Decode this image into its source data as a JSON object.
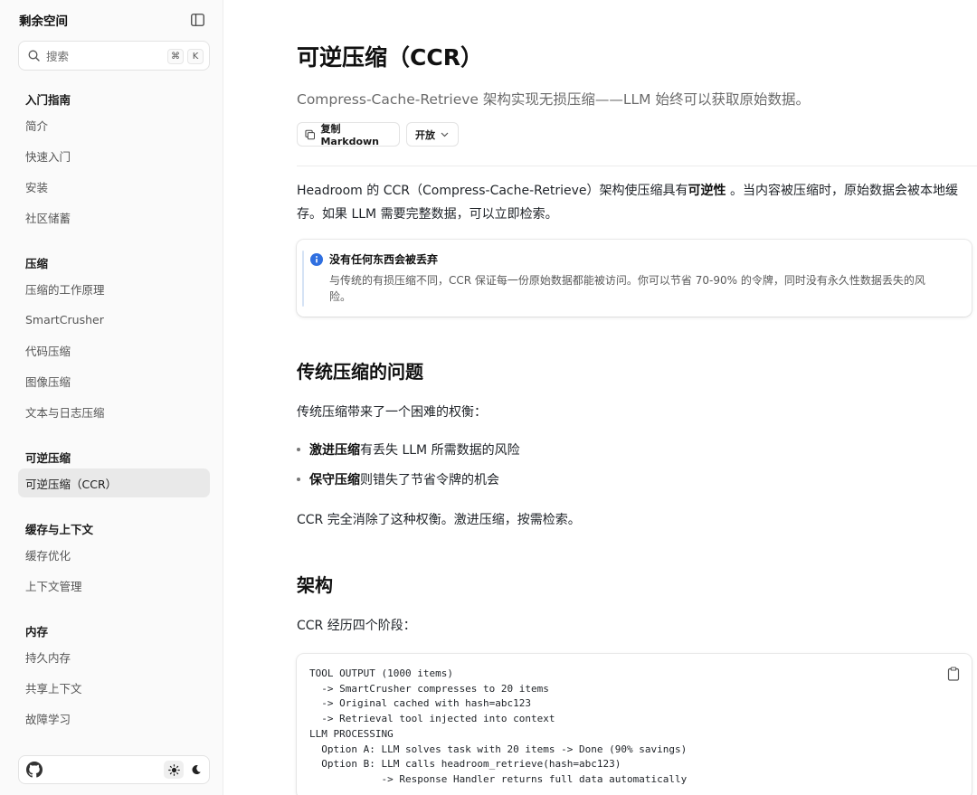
{
  "sidebar": {
    "brand": "剩余空间",
    "search": {
      "placeholder": "搜索",
      "kbd_cmd": "⌘",
      "kbd_key": "K"
    },
    "sections": [
      {
        "title": "入门指南",
        "items": [
          "简介",
          "快速入门",
          "安装",
          "社区储蓄"
        ]
      },
      {
        "title": "压缩",
        "items": [
          "压缩的工作原理",
          "SmartCrusher",
          "代码压缩",
          "图像压缩",
          "文本与日志压缩"
        ]
      },
      {
        "title": "可逆压缩",
        "items": [
          "可逆压缩（CCR）"
        ]
      },
      {
        "title": "缓存与上下文",
        "items": [
          "缓存优化",
          "上下文管理"
        ]
      },
      {
        "title": "内存",
        "items": [
          "持久内存",
          "共享上下文",
          "故障学习"
        ]
      }
    ],
    "active_item": "可逆压缩（CCR）"
  },
  "main": {
    "title": "可逆压缩（CCR）",
    "subtitle": "Compress-Cache-Retrieve 架构实现无损压缩——LLM 始终可以获取原始数据。",
    "copy_button": "复制 Markdown",
    "open_button": "开放",
    "intro": {
      "p1a": "Headroom 的 CCR（Compress-Cache-Retrieve）架构使压缩具有",
      "p1b": "可逆性",
      "p1c": " 。当内容被压缩时，原始数据会被本地缓",
      "p2": "存。如果 LLM 需要完整数据，可以立即检索。"
    },
    "callout": {
      "title": "没有任何东西会被丢弃",
      "line1": "与传统的有损压缩不同，CCR 保证每一份原始数据都能被访问。你可以节省 70-90% 的令牌，同时没有永久性数据丢失的风",
      "line2": "险。"
    },
    "section_problem": {
      "heading": "传统压缩的问题",
      "intro": "传统压缩带来了一个困难的权衡：",
      "bullets": [
        {
          "bold": "激进压缩",
          "rest": "有丢失 LLM 所需数据的风险"
        },
        {
          "bold": "保守压缩",
          "rest": "则错失了节省令牌的机会"
        }
      ],
      "conclusion": "CCR 完全消除了这种权衡。激进压缩，按需检索。"
    },
    "section_arch": {
      "heading": "架构",
      "intro": "CCR 经历四个阶段：",
      "code_lines": [
        "TOOL OUTPUT (1000 items)",
        "  -> SmartCrusher compresses to 20 items",
        "  -> Original cached with hash=abc123",
        "  -> Retrieval tool injected into context",
        "LLM PROCESSING",
        "  Option A: LLM solves task with 20 items -> Done (90% savings)",
        "  Option B: LLM calls headroom_retrieve(hash=abc123)",
        "            -> Response Handler returns full data automatically"
      ]
    }
  }
}
